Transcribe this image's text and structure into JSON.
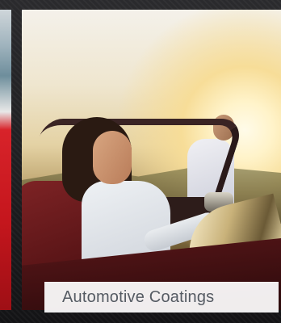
{
  "caption": {
    "label": "Automotive Coatings"
  }
}
